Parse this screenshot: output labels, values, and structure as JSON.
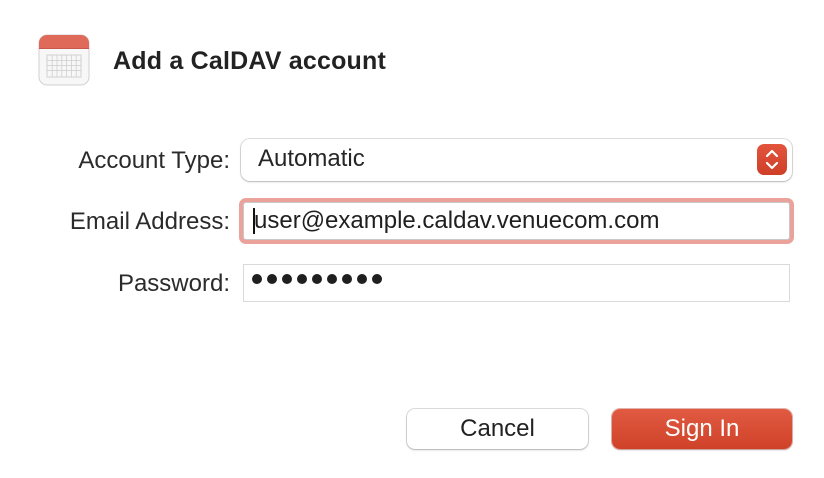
{
  "dialog": {
    "title": "Add a CalDAV account",
    "icon": "calendar-icon"
  },
  "form": {
    "account_type": {
      "label": "Account Type:",
      "value": "Automatic",
      "icon": "up-down-chevron-icon"
    },
    "email": {
      "label": "Email Address:",
      "value": "user@example.caldav.venuecom.com",
      "focused": true
    },
    "password": {
      "label": "Password:",
      "masked_length": 9
    }
  },
  "buttons": {
    "cancel_label": "Cancel",
    "sign_in_label": "Sign In"
  },
  "colors": {
    "accent": "#d9472e",
    "focus_ring": "#eaa29b",
    "calendar_header": "#e06a5a"
  }
}
